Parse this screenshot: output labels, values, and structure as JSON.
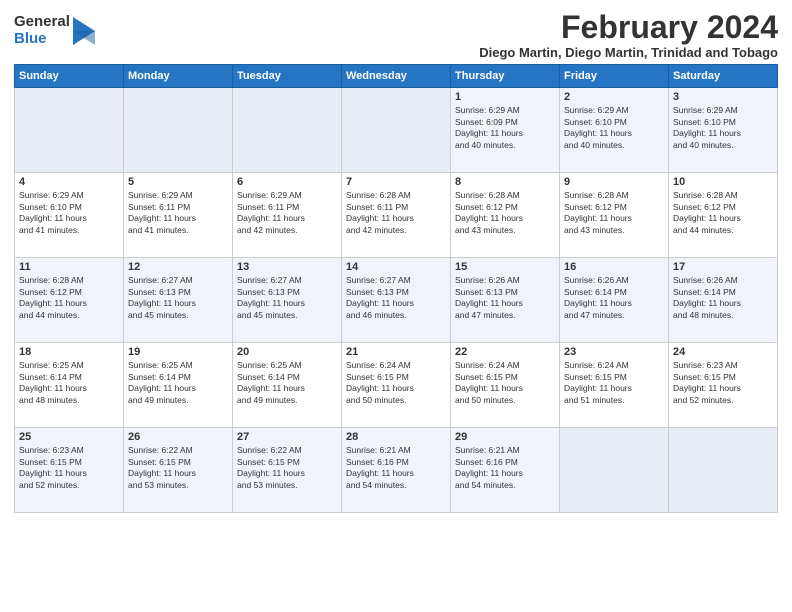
{
  "logo": {
    "general": "General",
    "blue": "Blue"
  },
  "header": {
    "title": "February 2024",
    "subtitle": "Diego Martin, Diego Martin, Trinidad and Tobago"
  },
  "days_of_week": [
    "Sunday",
    "Monday",
    "Tuesday",
    "Wednesday",
    "Thursday",
    "Friday",
    "Saturday"
  ],
  "weeks": [
    [
      {
        "day": "",
        "info": ""
      },
      {
        "day": "",
        "info": ""
      },
      {
        "day": "",
        "info": ""
      },
      {
        "day": "",
        "info": ""
      },
      {
        "day": "1",
        "info": "Sunrise: 6:29 AM\nSunset: 6:09 PM\nDaylight: 11 hours\nand 40 minutes."
      },
      {
        "day": "2",
        "info": "Sunrise: 6:29 AM\nSunset: 6:10 PM\nDaylight: 11 hours\nand 40 minutes."
      },
      {
        "day": "3",
        "info": "Sunrise: 6:29 AM\nSunset: 6:10 PM\nDaylight: 11 hours\nand 40 minutes."
      }
    ],
    [
      {
        "day": "4",
        "info": "Sunrise: 6:29 AM\nSunset: 6:10 PM\nDaylight: 11 hours\nand 41 minutes."
      },
      {
        "day": "5",
        "info": "Sunrise: 6:29 AM\nSunset: 6:11 PM\nDaylight: 11 hours\nand 41 minutes."
      },
      {
        "day": "6",
        "info": "Sunrise: 6:29 AM\nSunset: 6:11 PM\nDaylight: 11 hours\nand 42 minutes."
      },
      {
        "day": "7",
        "info": "Sunrise: 6:28 AM\nSunset: 6:11 PM\nDaylight: 11 hours\nand 42 minutes."
      },
      {
        "day": "8",
        "info": "Sunrise: 6:28 AM\nSunset: 6:12 PM\nDaylight: 11 hours\nand 43 minutes."
      },
      {
        "day": "9",
        "info": "Sunrise: 6:28 AM\nSunset: 6:12 PM\nDaylight: 11 hours\nand 43 minutes."
      },
      {
        "day": "10",
        "info": "Sunrise: 6:28 AM\nSunset: 6:12 PM\nDaylight: 11 hours\nand 44 minutes."
      }
    ],
    [
      {
        "day": "11",
        "info": "Sunrise: 6:28 AM\nSunset: 6:12 PM\nDaylight: 11 hours\nand 44 minutes."
      },
      {
        "day": "12",
        "info": "Sunrise: 6:27 AM\nSunset: 6:13 PM\nDaylight: 11 hours\nand 45 minutes."
      },
      {
        "day": "13",
        "info": "Sunrise: 6:27 AM\nSunset: 6:13 PM\nDaylight: 11 hours\nand 45 minutes."
      },
      {
        "day": "14",
        "info": "Sunrise: 6:27 AM\nSunset: 6:13 PM\nDaylight: 11 hours\nand 46 minutes."
      },
      {
        "day": "15",
        "info": "Sunrise: 6:26 AM\nSunset: 6:13 PM\nDaylight: 11 hours\nand 47 minutes."
      },
      {
        "day": "16",
        "info": "Sunrise: 6:26 AM\nSunset: 6:14 PM\nDaylight: 11 hours\nand 47 minutes."
      },
      {
        "day": "17",
        "info": "Sunrise: 6:26 AM\nSunset: 6:14 PM\nDaylight: 11 hours\nand 48 minutes."
      }
    ],
    [
      {
        "day": "18",
        "info": "Sunrise: 6:25 AM\nSunset: 6:14 PM\nDaylight: 11 hours\nand 48 minutes."
      },
      {
        "day": "19",
        "info": "Sunrise: 6:25 AM\nSunset: 6:14 PM\nDaylight: 11 hours\nand 49 minutes."
      },
      {
        "day": "20",
        "info": "Sunrise: 6:25 AM\nSunset: 6:14 PM\nDaylight: 11 hours\nand 49 minutes."
      },
      {
        "day": "21",
        "info": "Sunrise: 6:24 AM\nSunset: 6:15 PM\nDaylight: 11 hours\nand 50 minutes."
      },
      {
        "day": "22",
        "info": "Sunrise: 6:24 AM\nSunset: 6:15 PM\nDaylight: 11 hours\nand 50 minutes."
      },
      {
        "day": "23",
        "info": "Sunrise: 6:24 AM\nSunset: 6:15 PM\nDaylight: 11 hours\nand 51 minutes."
      },
      {
        "day": "24",
        "info": "Sunrise: 6:23 AM\nSunset: 6:15 PM\nDaylight: 11 hours\nand 52 minutes."
      }
    ],
    [
      {
        "day": "25",
        "info": "Sunrise: 6:23 AM\nSunset: 6:15 PM\nDaylight: 11 hours\nand 52 minutes."
      },
      {
        "day": "26",
        "info": "Sunrise: 6:22 AM\nSunset: 6:15 PM\nDaylight: 11 hours\nand 53 minutes."
      },
      {
        "day": "27",
        "info": "Sunrise: 6:22 AM\nSunset: 6:15 PM\nDaylight: 11 hours\nand 53 minutes."
      },
      {
        "day": "28",
        "info": "Sunrise: 6:21 AM\nSunset: 6:16 PM\nDaylight: 11 hours\nand 54 minutes."
      },
      {
        "day": "29",
        "info": "Sunrise: 6:21 AM\nSunset: 6:16 PM\nDaylight: 11 hours\nand 54 minutes."
      },
      {
        "day": "",
        "info": ""
      },
      {
        "day": "",
        "info": ""
      }
    ]
  ]
}
